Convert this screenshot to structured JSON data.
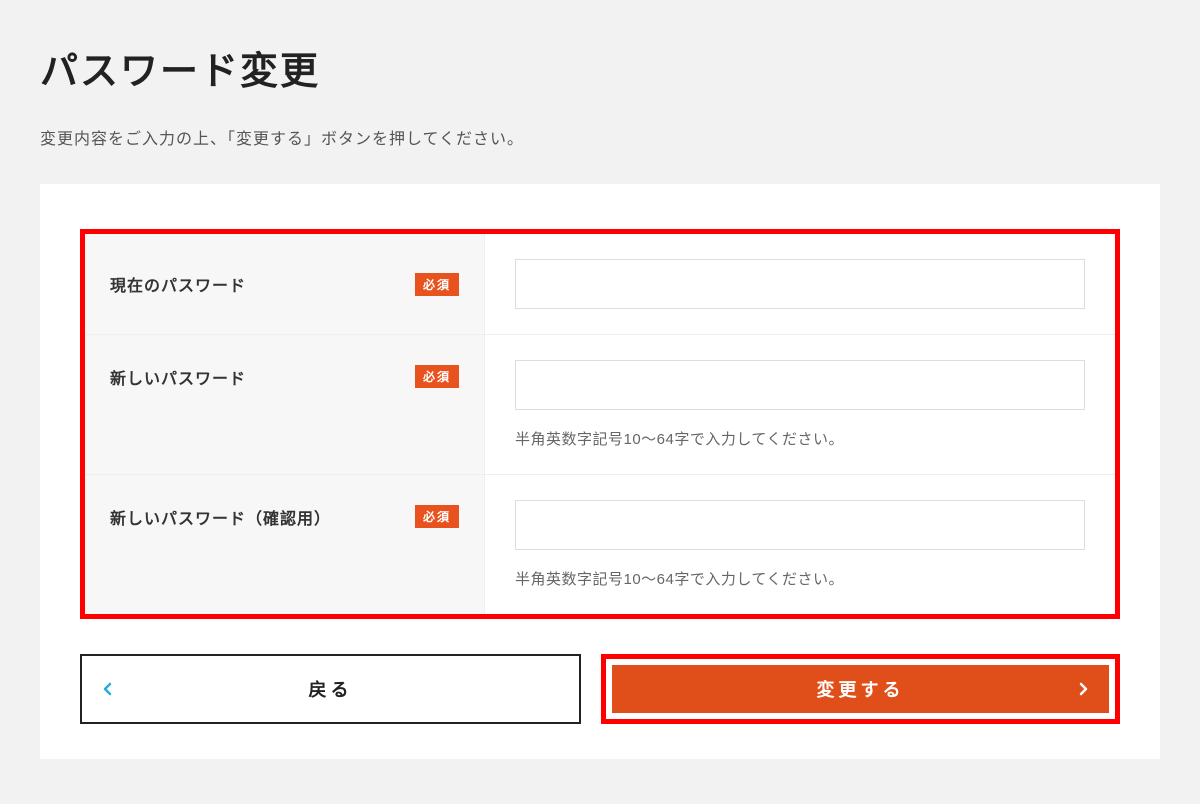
{
  "page": {
    "title": "パスワード変更",
    "description": "変更内容をご入力の上、「変更する」ボタンを押してください。"
  },
  "form": {
    "required_label": "必須",
    "rows": [
      {
        "label": "現在のパスワード",
        "help": null
      },
      {
        "label": "新しいパスワード",
        "help": "半角英数字記号10～64字で入力してください。"
      },
      {
        "label": "新しいパスワード（確認用）",
        "help": "半角英数字記号10～64字で入力してください。"
      }
    ]
  },
  "buttons": {
    "back": "戻る",
    "submit": "変更する"
  },
  "colors": {
    "accent": "#e04f1a",
    "highlight_border": "#ff0000"
  }
}
